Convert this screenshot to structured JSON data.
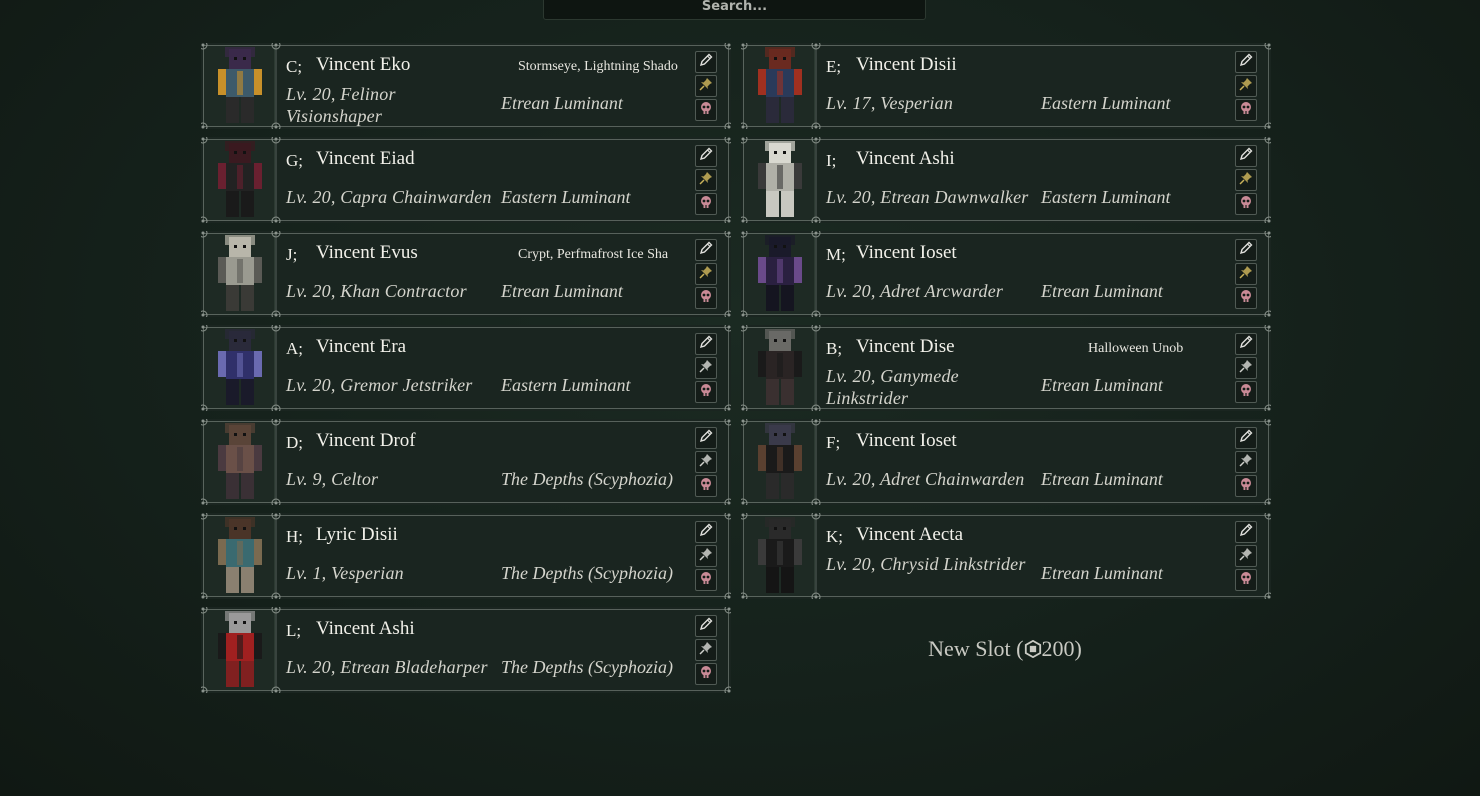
{
  "search": {
    "placeholder": "Search..."
  },
  "colors": {
    "accent_pin": "#c9b25a",
    "delete": "#c98a96",
    "frame": "#8a938c"
  },
  "left_column": [
    {
      "slot": "C;",
      "name": "Vincent Eko",
      "tag": "Stormseye, Lightning Shado",
      "level": "Lv. 20, Felinor Visionshaper",
      "faction": "Etrean Luminant",
      "palette": [
        "#3a2a4a",
        "#3d5a6a",
        "#c8902a",
        "#2a2a2a"
      ],
      "pin_active": true
    },
    {
      "slot": "G;",
      "name": "Vincent Eiad",
      "tag": "",
      "level": "Lv. 20, Capra Chainwarden",
      "faction": "Eastern Luminant",
      "palette": [
        "#3a1a20",
        "#222222",
        "#6a2030",
        "#1a1a1a"
      ],
      "pin_active": true
    },
    {
      "slot": "J;",
      "name": "Vincent Evus",
      "tag": "Crypt, Perfmafrost Ice Sha",
      "level": "Lv. 20, Khan Contractor",
      "faction": "Etrean Luminant",
      "palette": [
        "#b8b6aa",
        "#9a9a90",
        "#5a5a55",
        "#3a3a36"
      ],
      "pin_active": true
    },
    {
      "slot": "A;",
      "name": "Vincent Era",
      "tag": "",
      "level": "Lv. 20, Gremor Jetstriker",
      "faction": "Eastern Luminant",
      "palette": [
        "#2a2a3a",
        "#30306a",
        "#6a6ab0",
        "#1a1a2a"
      ],
      "pin_active": false
    },
    {
      "slot": "D;",
      "name": "Vincent Drof",
      "tag": "",
      "level": "Lv. 9, Celtor",
      "faction": "The Depths (Scyphozia)",
      "palette": [
        "#5a4438",
        "#6a5048",
        "#4a3a40",
        "#3a3035"
      ],
      "pin_active": false
    },
    {
      "slot": "H;",
      "name": "Lyric Disii",
      "tag": "",
      "level": "Lv. 1, Vesperian",
      "faction": "The Depths (Scyphozia)",
      "palette": [
        "#4a3428",
        "#3a6a70",
        "#7a6a50",
        "#8a8070"
      ],
      "pin_active": false
    },
    {
      "slot": "L;",
      "name": "Vincent Ashi",
      "tag": "",
      "level": "Lv. 20, Etrean Bladeharper",
      "faction": "The Depths (Scyphozia)",
      "palette": [
        "#9a9a9a",
        "#a02020",
        "#1a1a1a",
        "#802020"
      ],
      "pin_active": false
    }
  ],
  "right_column": [
    {
      "slot": "E;",
      "name": "Vincent Disii",
      "tag": "",
      "level": "Lv. 17, Vesperian",
      "faction": "Eastern Luminant",
      "palette": [
        "#6a2a20",
        "#2a3a5a",
        "#a03020",
        "#2a2a3a"
      ],
      "pin_active": true
    },
    {
      "slot": "I;",
      "name": "Vincent Ashi",
      "tag": "",
      "level": "Lv. 20, Etrean Dawnwalker",
      "faction": "Eastern Luminant",
      "palette": [
        "#d8d8d0",
        "#b0b0a8",
        "#3a3a3a",
        "#c8c8c0"
      ],
      "pin_active": true
    },
    {
      "slot": "M;",
      "name": "Vincent Ioset",
      "tag": "",
      "level": "Lv. 20, Adret Arcwarder",
      "faction": "Etrean Luminant",
      "palette": [
        "#1a1a2a",
        "#2a2040",
        "#6a4a8a",
        "#151520"
      ],
      "pin_active": true
    },
    {
      "slot": "B;",
      "name": "Vincent Dise",
      "tag": "Halloween Unob",
      "level": "Lv. 20, Ganymede Linkstrider",
      "faction": "Etrean Luminant",
      "palette": [
        "#6a6a66",
        "#2a2424",
        "#1a1a1a",
        "#3a3030"
      ],
      "pin_active": false
    },
    {
      "slot": "F;",
      "name": "Vincent Ioset",
      "tag": "",
      "level": "Lv. 20, Adret Chainwarden",
      "faction": "Etrean Luminant",
      "palette": [
        "#3a3a4a",
        "#1a1a1a",
        "#5a4030",
        "#2a2a2a"
      ],
      "pin_active": false
    },
    {
      "slot": "K;",
      "name": "Vincent Aecta",
      "tag": "",
      "level": "Lv. 20, Chrysid Linkstrider",
      "faction": "Etrean Luminant",
      "palette": [
        "#2a2a2a",
        "#1a1a1a",
        "#3a3a3a",
        "#151515"
      ],
      "pin_active": false
    }
  ],
  "new_slot": {
    "label": "New Slot (",
    "price": "200",
    "close": ")"
  },
  "icons": {
    "edit": "pencil-icon",
    "pin": "pin-icon",
    "delete": "skull-icon",
    "currency": "robux-icon"
  }
}
